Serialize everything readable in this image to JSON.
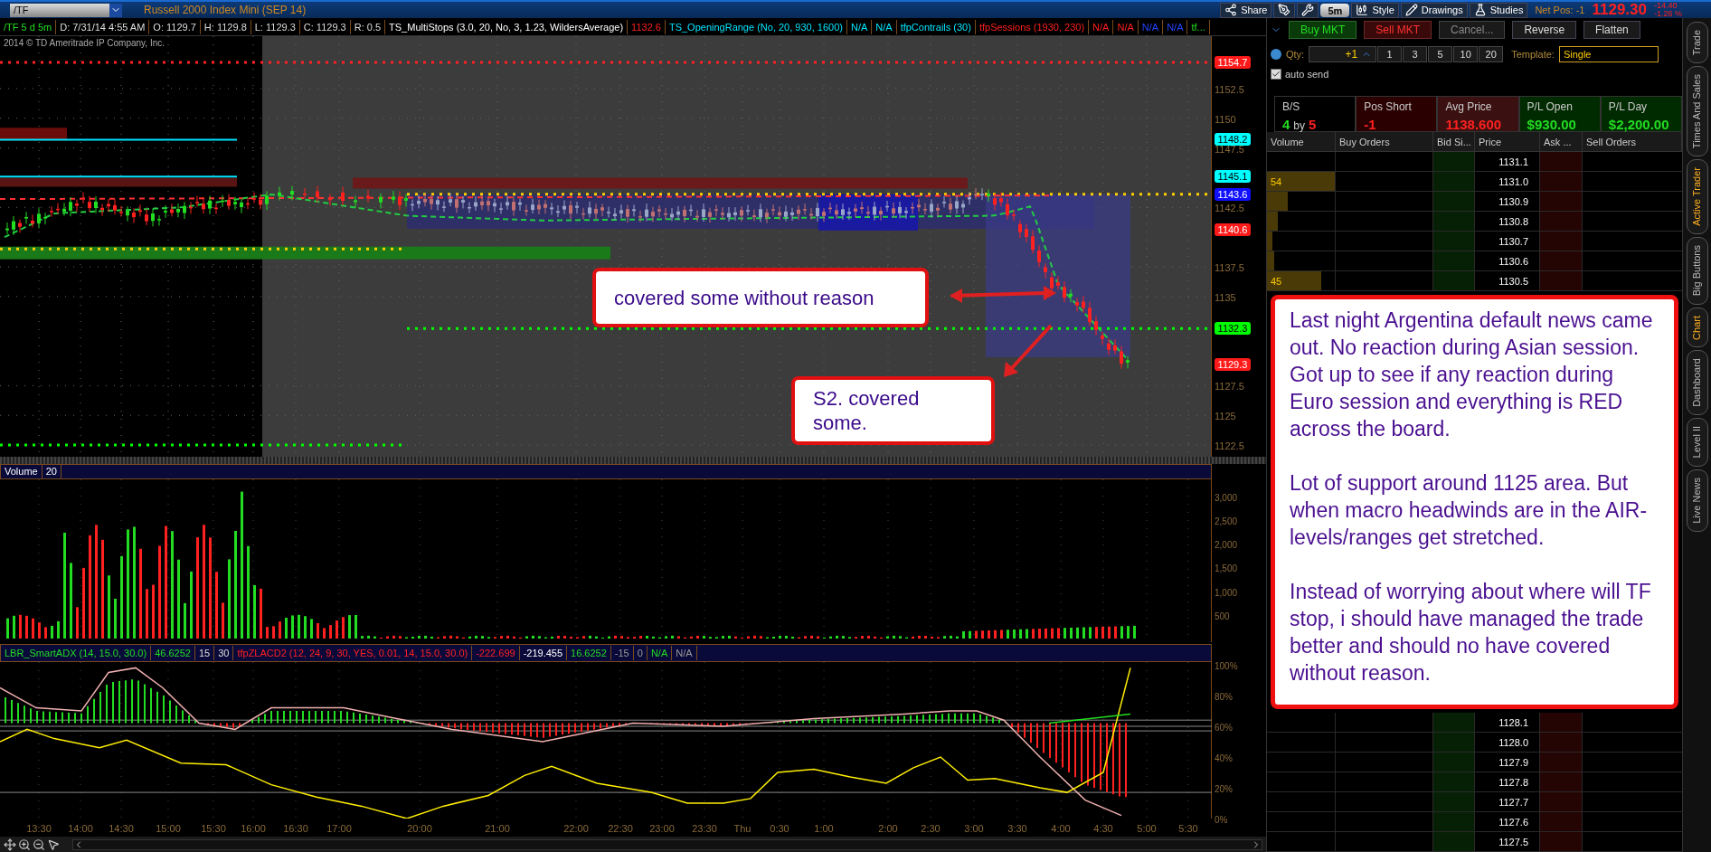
{
  "title_bar": {
    "symbol": "/TF",
    "instrument": "Russell 2000 Index Mini (SEP 14)",
    "tools": [
      {
        "kind": "share",
        "label": "Share"
      },
      {
        "kind": "drawtool"
      },
      {
        "kind": "wrench"
      },
      {
        "kind": "period",
        "label": "5m"
      },
      {
        "kind": "style",
        "label": "Style"
      },
      {
        "kind": "drawings",
        "label": "Drawings"
      },
      {
        "kind": "studies",
        "label": "Studies"
      }
    ],
    "net_pos": "Net Pos: -1",
    "last_price": "1129.30",
    "change": "-14.40",
    "change_pct": "-1.26 %"
  },
  "study_header": [
    {
      "text": "/TF 5 d 5m",
      "kind": "symbol"
    },
    {
      "text": "D: 7/31/14 4:55 AM",
      "kind": "quote"
    },
    {
      "text": "O: 1129.7",
      "kind": "quote"
    },
    {
      "text": "H: 1129.8",
      "kind": "quote"
    },
    {
      "text": "L: 1129.3",
      "kind": "quote"
    },
    {
      "text": "C: 1129.3",
      "kind": "quote"
    },
    {
      "text": "R: 0.5",
      "kind": "quote"
    },
    {
      "text": "TS_MultiStops (3.0, 20, No, 3, 1.23, WildersAverage)",
      "kind": "title"
    },
    {
      "text": "1132.6",
      "kind": "stop"
    },
    {
      "text": "TS_OpeningRange (No, 20, 930, 1600)",
      "kind": "range"
    },
    {
      "text": "N/A",
      "kind": "range"
    },
    {
      "text": "N/A",
      "kind": "range"
    },
    {
      "text": "tfpContrails (30)",
      "kind": "range"
    },
    {
      "text": "tfpSessions (1930, 230)",
      "kind": "stop"
    },
    {
      "text": "N/A",
      "kind": "stop"
    },
    {
      "text": "N/A",
      "kind": "stop"
    },
    {
      "text": "N/A",
      "kind": "pivot"
    },
    {
      "text": "N/A",
      "kind": "pivot"
    },
    {
      "text": "tf...",
      "kind": "symbol"
    }
  ],
  "copyright": "2014 © TD Ameritrade IP Company, Inc.",
  "price_axis": [
    "1152.5",
    "1150",
    "1147.5",
    "1142.5",
    "1137.5",
    "1135",
    "1127.5",
    "1125",
    "1122.5"
  ],
  "price_markers": [
    {
      "text": "1154.7",
      "color": "#ff1a1a"
    },
    {
      "text": "1148.2",
      "color": "#00ffff"
    },
    {
      "text": "1145.1",
      "color": "#00ffff"
    },
    {
      "text": "1143.6",
      "color": "#1010ff"
    },
    {
      "text": "1140.6",
      "color": "#ff1a1a"
    },
    {
      "text": "1132.3",
      "color": "#00ff00"
    },
    {
      "text": "1129.3",
      "color": "#ff1a1a"
    }
  ],
  "callouts": [
    {
      "text": "covered some without reason"
    },
    {
      "text": "S2. covered some."
    }
  ],
  "volume_header": [
    "Volume",
    "20"
  ],
  "volume_axis": [
    "3,000",
    "2,500",
    "2,000",
    "1,500",
    "1,000",
    "500"
  ],
  "indicator_header": [
    {
      "text": "LBR_SmartADX (14, 15.0, 30.0)",
      "kind": "symbol"
    },
    {
      "text": "46.6252",
      "kind": "symbol"
    },
    {
      "text": "15",
      "kind": "quote"
    },
    {
      "text": "30",
      "kind": "quote"
    },
    {
      "text": "tfpZLACD2 (12, 24, 9, 30, YES, 0.01, 14, 15.0, 30.0)",
      "kind": "stop"
    },
    {
      "text": "-222.699",
      "kind": "stop"
    },
    {
      "text": "-219.455",
      "kind": "title"
    },
    {
      "text": "16.6252",
      "kind": "symbol"
    },
    {
      "text": "-15",
      "kind": "muted"
    },
    {
      "text": "0",
      "kind": "muted"
    },
    {
      "text": "N/A",
      "kind": "symbol"
    },
    {
      "text": "N/A",
      "kind": "muted"
    }
  ],
  "indicator_axis": [
    "100%",
    "80%",
    "60%",
    "40%",
    "20%",
    "0%"
  ],
  "time_axis": [
    "13:30",
    "14:00",
    "14:30",
    "15:00",
    "15:30",
    "16:00",
    "16:30",
    "17:00",
    "20:00",
    "21:00",
    "22:00",
    "22:30",
    "23:00",
    "23:30",
    "Thu",
    "0:30",
    "1:00",
    "2:00",
    "2:30",
    "3:00",
    "3:30",
    "4:00",
    "4:30",
    "5:00",
    "5:30"
  ],
  "order_buttons": [
    {
      "kind": "buy",
      "label": "Buy MKT"
    },
    {
      "kind": "sell",
      "label": "Sell MKT"
    },
    {
      "kind": "cancel",
      "label": "Cancel..."
    },
    {
      "kind": "plain",
      "label": "Reverse"
    },
    {
      "kind": "plain",
      "label": "Flatten"
    }
  ],
  "qty": {
    "label": "Qty:",
    "value": "+1",
    "presets": [
      "1",
      "3",
      "5",
      "10",
      "20"
    ]
  },
  "template": {
    "label": "Template:",
    "value": "Single"
  },
  "auto_send": {
    "label": "auto send",
    "checked": true
  },
  "position": [
    {
      "kind": "bs",
      "title": "B/S",
      "bid": "4",
      "by": "by",
      "ask": "5"
    },
    {
      "kind": "short",
      "title": "Pos Short",
      "value": "-1"
    },
    {
      "kind": "avg",
      "title": "Avg Price",
      "value": "1138.600"
    },
    {
      "kind": "pl",
      "title": "P/L Open",
      "value": "$930.00"
    },
    {
      "kind": "pl",
      "title": "P/L Day",
      "value": "$2,200.00"
    }
  ],
  "ladder": {
    "columns": [
      "Volume",
      "Buy Orders",
      "Bid Si...",
      "Price",
      "Ask ...",
      "Sell Orders"
    ],
    "rows_top": [
      {
        "price": "1131.1"
      },
      {
        "price": "1131.0",
        "volume": "54",
        "level": 1
      },
      {
        "price": "1130.9",
        "level": 0.3
      },
      {
        "price": "1130.8",
        "level": 0.16
      },
      {
        "price": "1130.7",
        "level": 0.08
      },
      {
        "price": "1130.6",
        "level": 0.1
      },
      {
        "price": "1130.5",
        "volume": "45",
        "level": 0.8
      }
    ],
    "rows_bottom": [
      {
        "price": "1128.1"
      },
      {
        "price": "1128.0"
      },
      {
        "price": "1127.9"
      },
      {
        "price": "1127.8"
      },
      {
        "price": "1127.7"
      },
      {
        "price": "1127.6"
      },
      {
        "price": "1127.5"
      }
    ]
  },
  "note": {
    "paragraphs": [
      "Last night Argentina default news came out. No reaction during Asian session. Got up to see if any reaction during Euro session and everything is RED across the board.",
      "Lot of support around 1125 area. But when macro headwinds are in the AIR- levels/ranges get stretched.",
      "Instead of worrying about where will TF stop, i should have managed the trade better and should no have covered without reason."
    ]
  },
  "side_tabs": [
    {
      "label": "Trade",
      "selected": false
    },
    {
      "label": "Times And Sales",
      "selected": false
    },
    {
      "label": "Active Trader",
      "selected": true
    },
    {
      "label": "Big Buttons",
      "selected": false
    },
    {
      "label": "Chart",
      "selected": true
    },
    {
      "label": "Dashboard",
      "selected": false
    },
    {
      "label": "Level II",
      "selected": false
    },
    {
      "label": "Live News",
      "selected": false
    }
  ]
}
